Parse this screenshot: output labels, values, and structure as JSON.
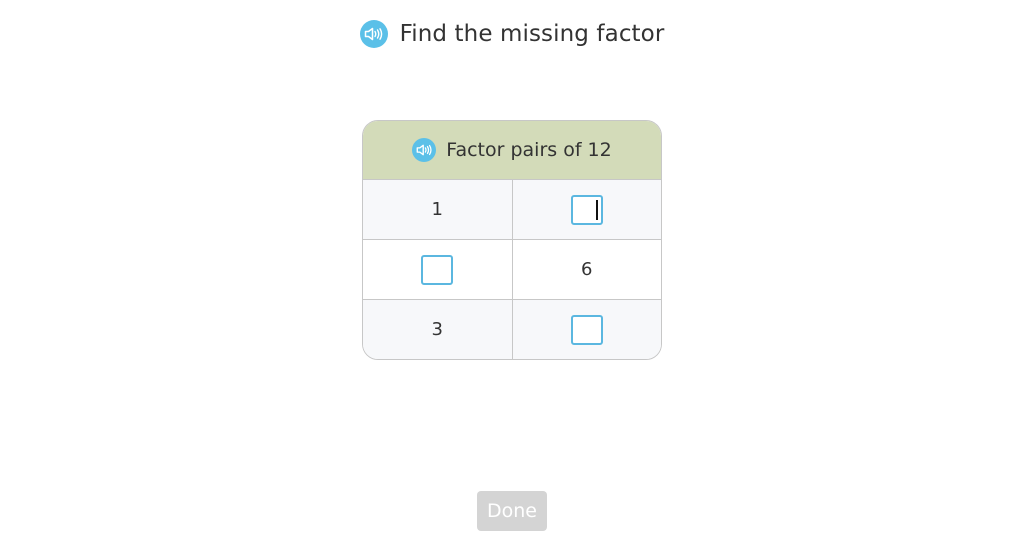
{
  "prompt": {
    "text": "Find the missing factor",
    "icon": "speaker-icon"
  },
  "table": {
    "header": "Factor pairs of 12",
    "header_icon": "speaker-icon",
    "rows": [
      {
        "left": "1",
        "right": ""
      },
      {
        "left": "",
        "right": "6"
      },
      {
        "left": "3",
        "right": ""
      }
    ]
  },
  "done_button": {
    "label": "Done"
  },
  "colors": {
    "speaker": "#5bc0e8",
    "header_bg": "#d3dbb9",
    "input_border": "#5bb7e0",
    "done_bg": "#d4d4d4"
  }
}
